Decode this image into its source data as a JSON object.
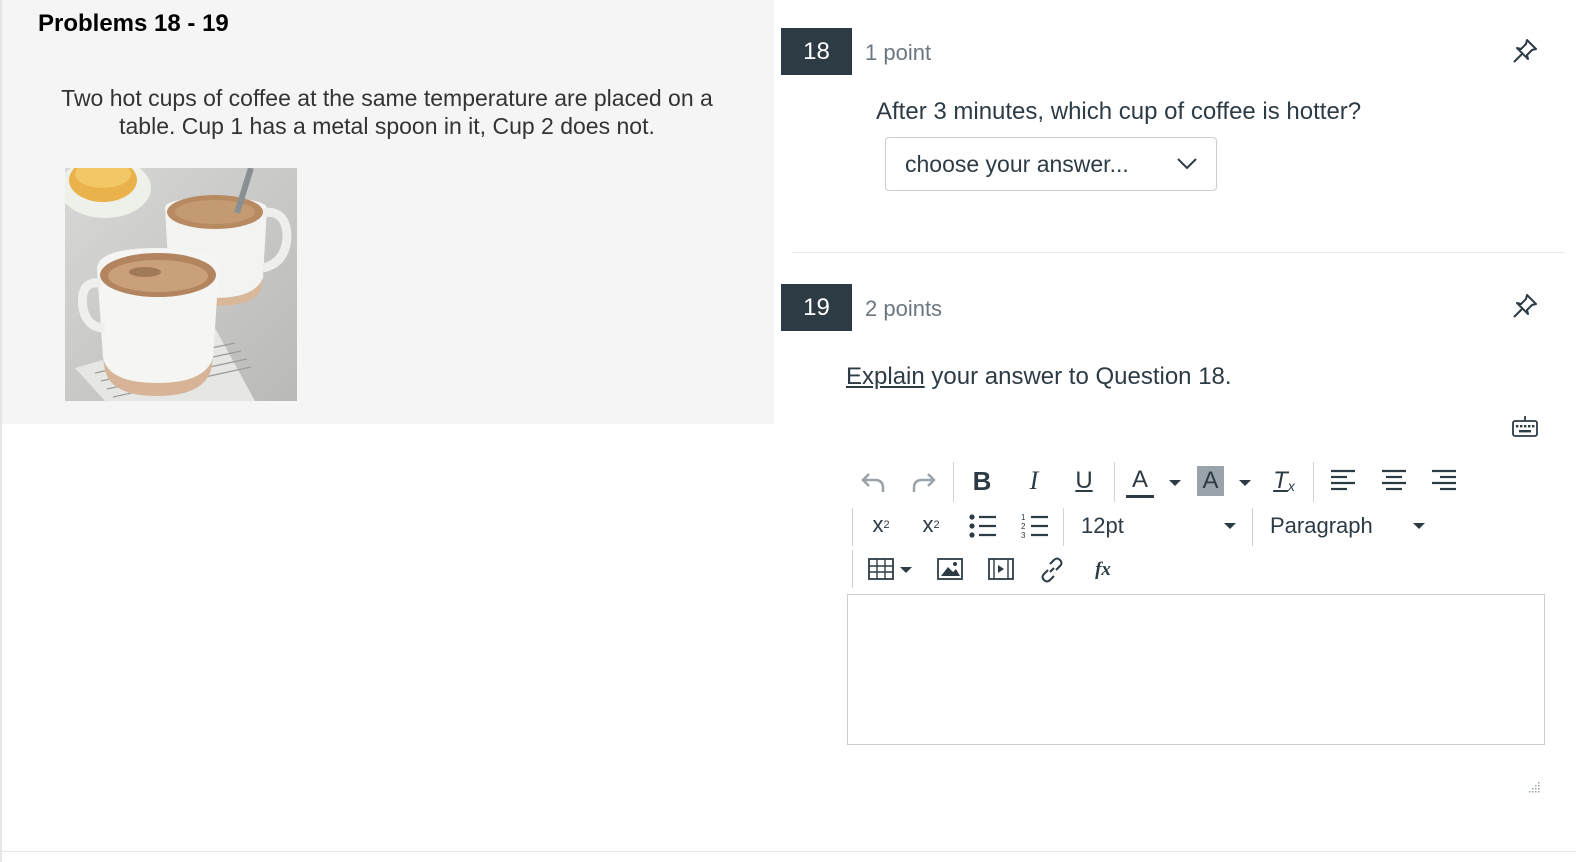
{
  "stimulus": {
    "title": "Problems 18 - 19",
    "text": "Two hot cups of coffee at the same temperature are placed on a table. Cup 1 has a metal spoon in it, Cup 2 does not.",
    "image_icon": "coffee-cups-photo"
  },
  "q18": {
    "number": "18",
    "points": "1 point",
    "text": "After 3 minutes, which cup of coffee is hotter?",
    "select_value": "choose your answer...",
    "icons": [
      "pin-icon",
      "chevron-down-icon"
    ]
  },
  "q19": {
    "number": "19",
    "points": "2 points",
    "text_link": "Explain",
    "text_rest": " your answer to Question 18.",
    "icons": [
      "pin-icon",
      "keyboard-icon"
    ]
  },
  "editor": {
    "font_size": "12pt",
    "block_format": "Paragraph",
    "toolbar_icons": [
      "undo-icon",
      "redo-icon",
      "bold-icon",
      "italic-icon",
      "underline-icon",
      "text-color-icon",
      "background-color-icon",
      "clear-formatting-icon",
      "align-left-icon",
      "align-center-icon",
      "align-right-icon",
      "superscript-icon",
      "subscript-icon",
      "bullet-list-icon",
      "numbered-list-icon",
      "table-icon",
      "image-icon",
      "media-icon",
      "link-icon",
      "equation-icon"
    ],
    "labels": {
      "bold": "B",
      "italic": "I",
      "underline": "U",
      "text_color": "A",
      "bg_color": "A",
      "clear_format": "T",
      "clear_format_sub": "x",
      "superscript": "x",
      "superscript_num": "2",
      "subscript": "x",
      "subscript_num": "2",
      "equation": "fx"
    }
  },
  "colors": {
    "badge": "#2d3b45",
    "panel": "#f5f5f5",
    "text": "#2d3b45",
    "muted": "#6b7780",
    "border": "#c7cdd1"
  }
}
